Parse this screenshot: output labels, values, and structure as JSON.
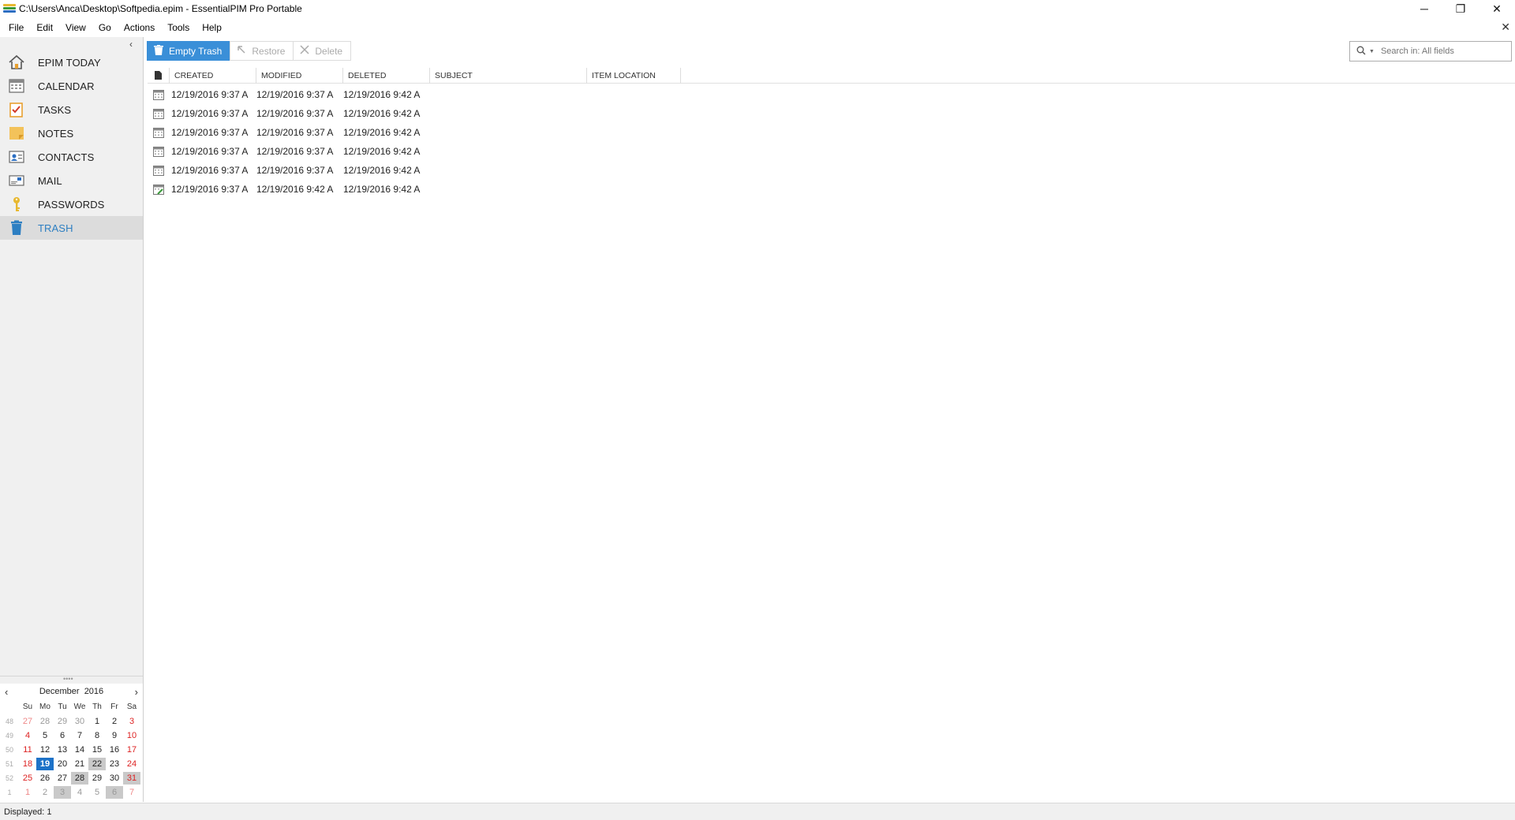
{
  "window": {
    "title": "C:\\Users\\Anca\\Desktop\\Softpedia.epim - EssentialPIM Pro Portable",
    "minimize": "─",
    "restore": "❐",
    "close": "✕"
  },
  "menu": {
    "items": [
      "File",
      "Edit",
      "View",
      "Go",
      "Actions",
      "Tools",
      "Help"
    ],
    "close_doc": "✕"
  },
  "sidebar": {
    "collapse": "‹",
    "items": [
      {
        "label": "EPIM TODAY",
        "icon": "home-icon"
      },
      {
        "label": "CALENDAR",
        "icon": "calendar-icon"
      },
      {
        "label": "TASKS",
        "icon": "tasks-icon"
      },
      {
        "label": "NOTES",
        "icon": "notes-icon"
      },
      {
        "label": "CONTACTS",
        "icon": "contacts-icon"
      },
      {
        "label": "MAIL",
        "icon": "mail-icon"
      },
      {
        "label": "PASSWORDS",
        "icon": "key-icon"
      },
      {
        "label": "TRASH",
        "icon": "trash-icon",
        "active": true
      }
    ]
  },
  "calendar": {
    "month": "December",
    "year": "2016",
    "prev": "‹",
    "next": "›",
    "weekdays": [
      "Su",
      "Mo",
      "Tu",
      "We",
      "Th",
      "Fr",
      "Sa"
    ],
    "weeks": [
      {
        "wk": "48",
        "days": [
          "27",
          "28",
          "29",
          "30",
          "1",
          "2",
          "3"
        ]
      },
      {
        "wk": "49",
        "days": [
          "4",
          "5",
          "6",
          "7",
          "8",
          "9",
          "10"
        ]
      },
      {
        "wk": "50",
        "days": [
          "11",
          "12",
          "13",
          "14",
          "15",
          "16",
          "17"
        ]
      },
      {
        "wk": "51",
        "days": [
          "18",
          "19",
          "20",
          "21",
          "22",
          "23",
          "24"
        ]
      },
      {
        "wk": "52",
        "days": [
          "25",
          "26",
          "27",
          "28",
          "29",
          "30",
          "31"
        ]
      },
      {
        "wk": "1",
        "days": [
          "1",
          "2",
          "3",
          "4",
          "5",
          "6",
          "7"
        ]
      }
    ],
    "today": "19"
  },
  "toolbar": {
    "empty_trash": "Empty Trash",
    "restore": "Restore",
    "delete": "Delete"
  },
  "search": {
    "placeholder": "Search in: All fields"
  },
  "grid": {
    "columns": [
      "CREATED",
      "MODIFIED",
      "DELETED",
      "SUBJECT",
      "ITEM LOCATION"
    ],
    "rows": [
      {
        "created": "12/19/2016 9:37 A",
        "modified": "12/19/2016 9:37 A",
        "deleted": "12/19/2016 9:42 A",
        "icon": "calendar-item-icon"
      },
      {
        "created": "12/19/2016 9:37 A",
        "modified": "12/19/2016 9:37 A",
        "deleted": "12/19/2016 9:42 A",
        "icon": "calendar-item-icon"
      },
      {
        "created": "12/19/2016 9:37 A",
        "modified": "12/19/2016 9:37 A",
        "deleted": "12/19/2016 9:42 A",
        "icon": "calendar-item-icon"
      },
      {
        "created": "12/19/2016 9:37 A",
        "modified": "12/19/2016 9:37 A",
        "deleted": "12/19/2016 9:42 A",
        "icon": "calendar-item-icon"
      },
      {
        "created": "12/19/2016 9:37 A",
        "modified": "12/19/2016 9:37 A",
        "deleted": "12/19/2016 9:42 A",
        "icon": "calendar-item-icon"
      },
      {
        "created": "12/19/2016 9:37 A",
        "modified": "12/19/2016 9:42 A",
        "deleted": "12/19/2016 9:42 A",
        "icon": "calendar-edit-icon"
      }
    ]
  },
  "status": {
    "text": "Displayed: 1"
  }
}
